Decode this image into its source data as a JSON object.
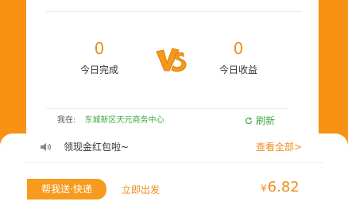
{
  "stats": {
    "completed": {
      "value": "0",
      "label": "今日完成"
    },
    "earnings": {
      "value": "0",
      "label": "今日收益"
    }
  },
  "location": {
    "prefix": "我在:",
    "address": "东城新区天元商务中心",
    "refresh_label": "刷新"
  },
  "notice": {
    "text": "领现金红包啦~",
    "view_all": "查看全部>"
  },
  "order": {
    "tag": "帮我送·快递",
    "status": "立即出发",
    "price_symbol": "¥",
    "price_value": "6.82"
  },
  "colors": {
    "brand_orange": "#F79215",
    "accent_orange": "#F08C1C",
    "green": "#3FA93F"
  }
}
